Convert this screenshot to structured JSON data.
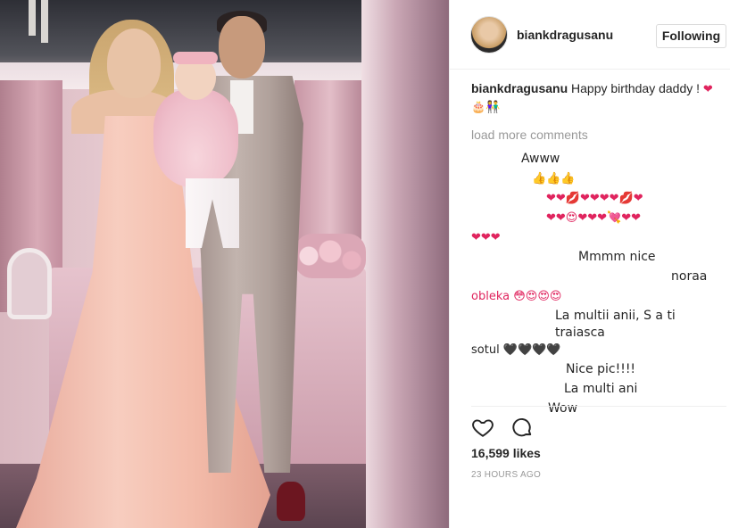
{
  "post": {
    "username": "biankdragusanu",
    "follow_label": "Following",
    "caption_user": "biankdragusanu",
    "caption_text": "Happy birthday daddy !",
    "caption_emoji": "❤ 🎂👫",
    "load_more": "load more comments",
    "comments": [
      {
        "text": "Awww",
        "indent": 56
      },
      {
        "text": "👍👍👍",
        "indent": 68
      },
      {
        "text": "❤❤💋❤❤❤❤💋❤",
        "indent": 84
      },
      {
        "text": "❤❤😍❤❤❤💘❤❤",
        "indent": 84
      },
      {
        "text": "❤❤❤",
        "indent": 0
      },
      {
        "text": "Mmmm nice",
        "indent": 120
      },
      {
        "text": "noraa",
        "indent": 224
      },
      {
        "text": "obleka 😳😍😍😍",
        "indent": 0
      },
      {
        "text": "La multii anii, S a ti traiasca",
        "indent": 94
      },
      {
        "text": "sotul 🖤🖤🖤🖤",
        "indent": 0
      },
      {
        "text": "Nice pic!!!!",
        "indent": 106
      },
      {
        "text": "La multi ani",
        "indent": 104
      },
      {
        "text": "Wow",
        "indent": 86
      }
    ],
    "likes": "16,599 likes",
    "time_ago": "23 HOURS AGO"
  },
  "icons": {
    "like": "heart-outline-icon",
    "comment": "comment-bubble-icon"
  },
  "colors": {
    "text": "#262626",
    "muted": "#999999",
    "border": "#dbdbdb",
    "heart": "#e0245e"
  }
}
